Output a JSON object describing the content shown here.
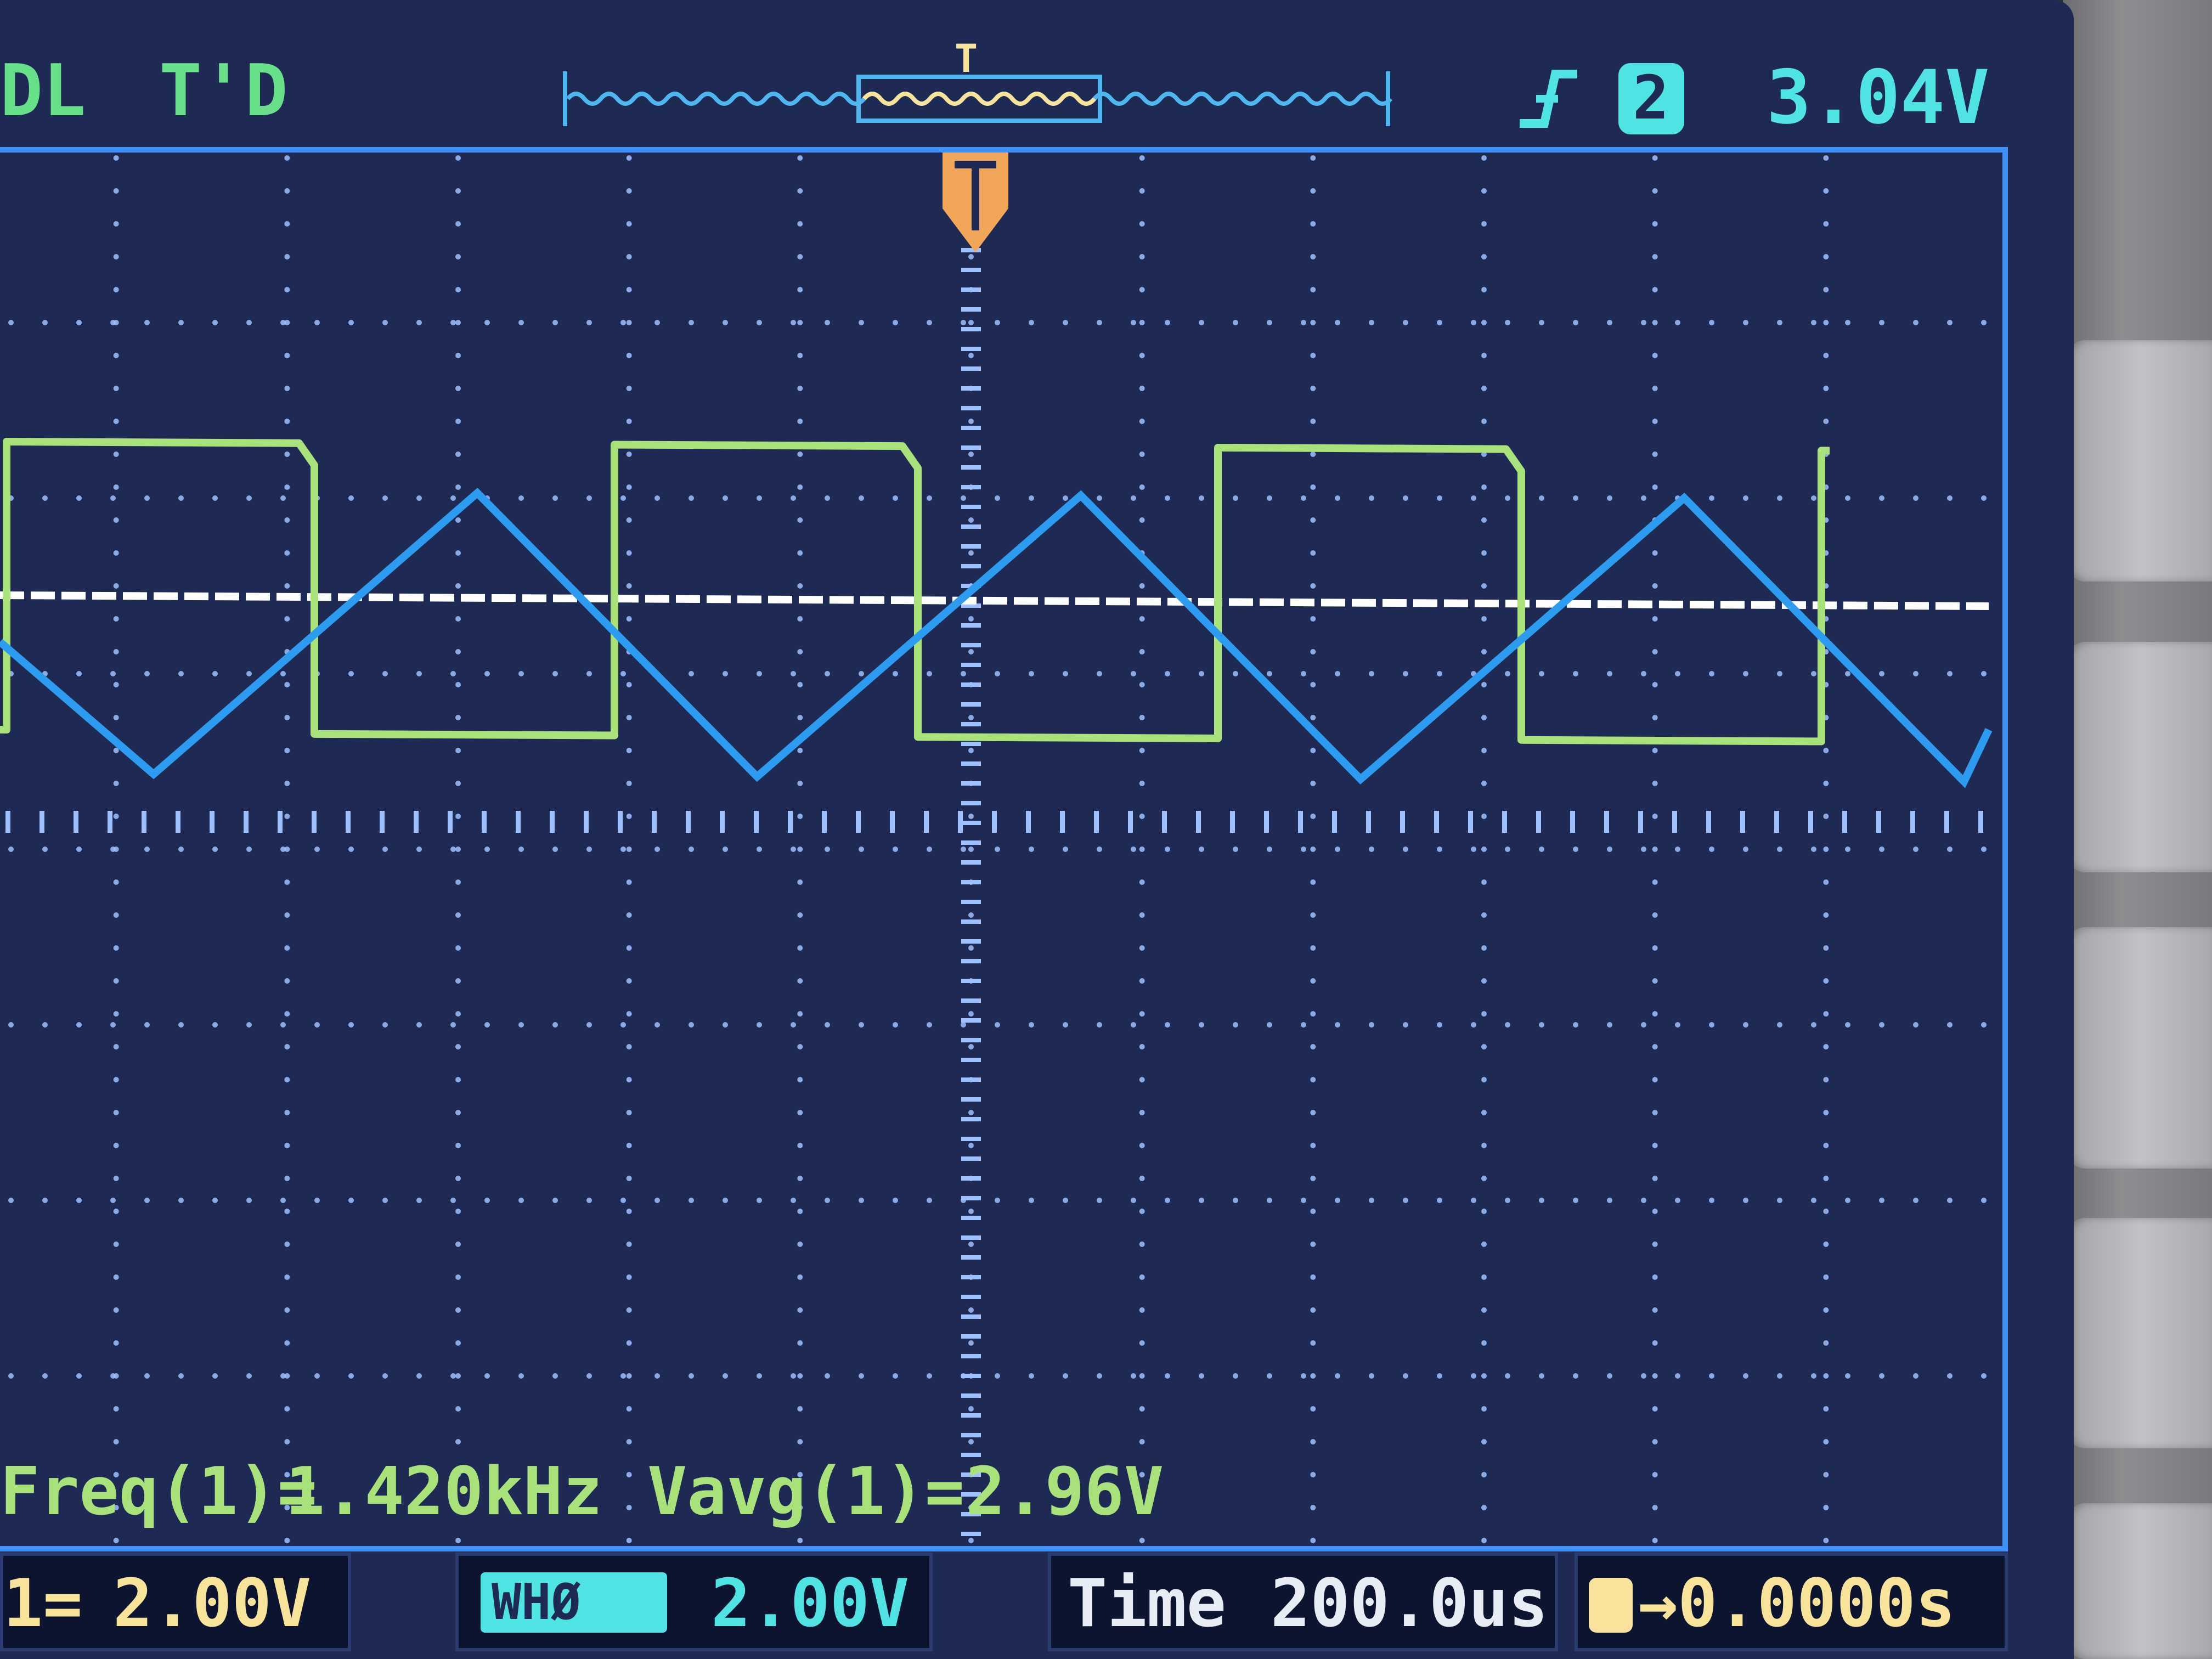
{
  "header": {
    "mode": "DL",
    "status": "T'D",
    "trigger_slope": "rising-edge-icon",
    "trigger_source": "2",
    "trigger_level": "3.04V",
    "trigger_marker_label": "T"
  },
  "measurements": {
    "freq_label": "Freq(1)=",
    "freq_value": "1.420kHz",
    "vavg_label": "Vavg(1)=",
    "vavg_value": "2.96V"
  },
  "footer": {
    "ch1_scale": "2.00V",
    "ch2_badge": "WHØ",
    "ch2_scale": "2.00V",
    "time_label": "Time",
    "time_value": "200.0us",
    "trigger_offset": "→0.0000s"
  },
  "colors": {
    "screen": "#1f2a54",
    "grid": "#9fc0ff",
    "ch1_trace": "#a9e17a",
    "ch2_trace": "#2d9cf0",
    "trigger_line": "#ffffff",
    "text_yellow": "#f7e39a",
    "text_cyan": "#4fe3e3",
    "text_green": "#68e08a",
    "marker_orange": "#f2a65a"
  }
}
